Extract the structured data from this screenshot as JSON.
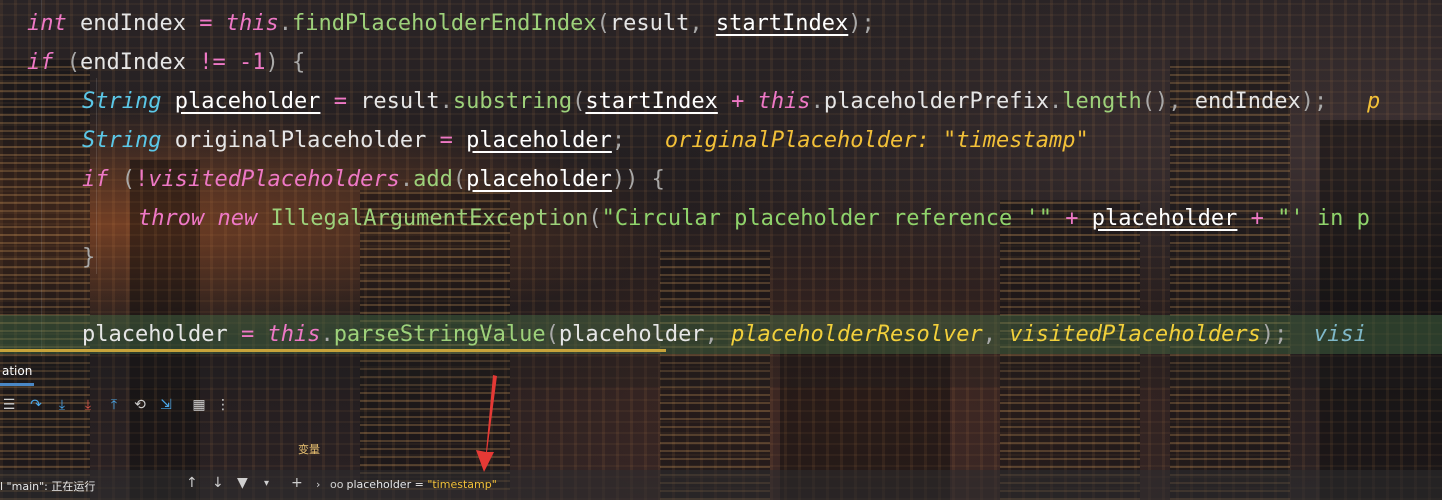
{
  "code": {
    "line1": {
      "kw_int": "int",
      "name": "endIndex",
      "eq": "=",
      "kw_this": "this",
      "dot": ".",
      "method": "findPlaceholderEndIndex",
      "open": "(",
      "arg1": "result",
      "comma": ",",
      "arg2": "startIndex",
      "close": ");"
    },
    "line2": {
      "kw_if": "if",
      "open": "(",
      "name": "endIndex",
      "op": "!=",
      "num": "-1",
      "close": ")",
      "brace": "{"
    },
    "line3": {
      "type": "String",
      "name": "placeholder",
      "eq": "=",
      "obj": "result",
      "dot": ".",
      "method": "substring",
      "open": "(",
      "arg1": "startIndex",
      "plus": "+",
      "kw_this": "this",
      "dot2": ".",
      "field": "placeholderPrefix",
      "dot3": ".",
      "method2": "length",
      "parens": "()",
      "comma": ",",
      "arg2": "endIndex",
      "close": ");",
      "hint": "p"
    },
    "line4": {
      "type": "String",
      "name": "originalPlaceholder",
      "eq": "=",
      "value": "placeholder",
      "semi": ";",
      "hint": "originalPlaceholder: \"timestamp\""
    },
    "line5": {
      "kw_if": "if",
      "open": "(",
      "not": "!",
      "field": "visitedPlaceholders",
      "dot": ".",
      "method": "add",
      "open2": "(",
      "arg": "placeholder",
      "close": "))",
      "brace": "{"
    },
    "line6": {
      "kw_throw": "throw",
      "kw_new": "new",
      "cls": "IllegalArgumentException",
      "open": "(",
      "str1": "\"Circular placeholder reference '\"",
      "plus": "+",
      "arg": "placeholder",
      "plus2": "+",
      "str2": "\"' in p"
    },
    "line7": {
      "brace": "}"
    },
    "line8": {
      "name": "placeholder",
      "eq": "=",
      "kw_this": "this",
      "dot": ".",
      "method": "parseStringValue",
      "open": "(",
      "arg1": "placeholder",
      "comma": ",",
      "arg2": "placeholderResolver",
      "comma2": ",",
      "arg3": "visitedPlaceholders",
      "close": ");",
      "hint": "visi"
    }
  },
  "debug": {
    "tab_label": "ation",
    "panel_title": "变量",
    "thread_label": "l \"main\": 正在运行",
    "variable": {
      "name": "placeholder",
      "eq": " = ",
      "value": "\"timestamp\""
    }
  },
  "colors": {
    "keyword": "#ee78c5",
    "type": "#5bc8e8",
    "method": "#9dd17a",
    "inlay_hint": "#f2c038",
    "exec_line": "#466e46",
    "tab_accent": "#4a88c7",
    "arrow": "#e53935"
  }
}
